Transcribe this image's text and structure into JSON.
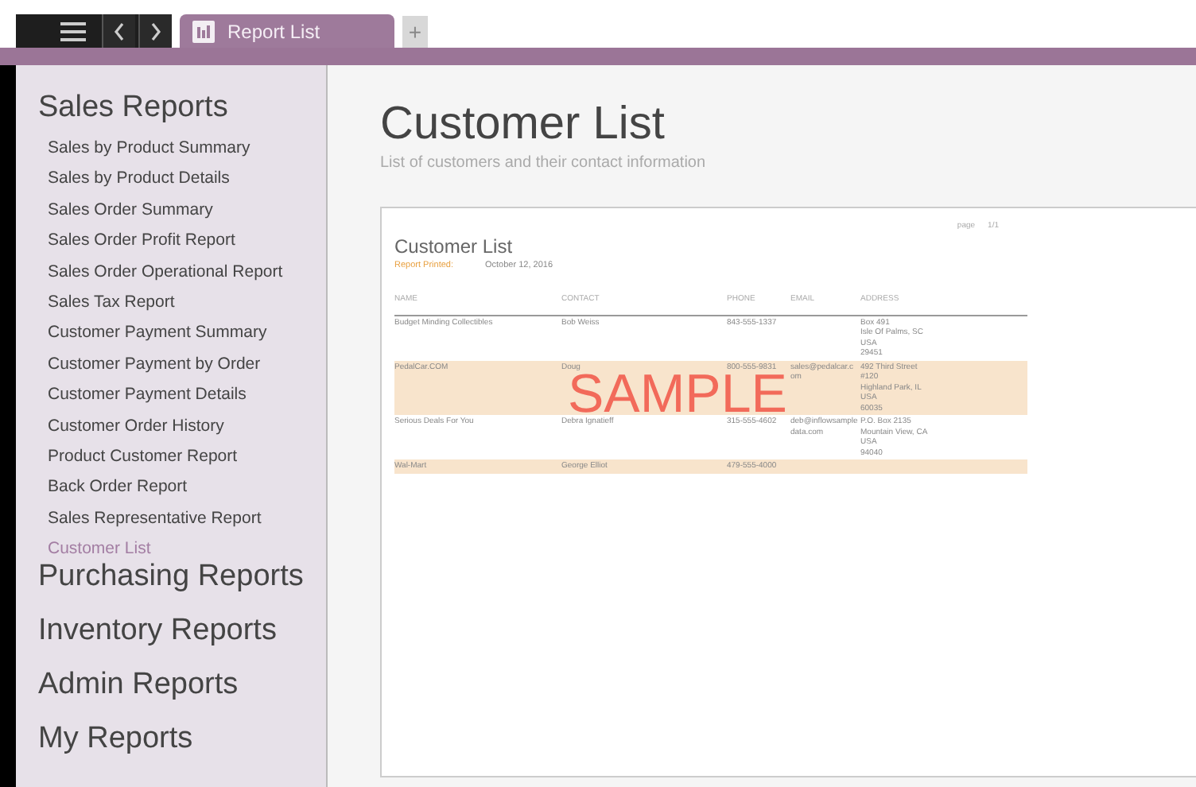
{
  "toolbar": {
    "tabs": [
      {
        "label": "Report List",
        "selected": true
      }
    ],
    "new_tab": "+"
  },
  "sidebar": {
    "groups": [
      {
        "title": "Sales Reports",
        "expanded": true,
        "items": [
          {
            "label": "Sales by Product Summary",
            "selected": false
          },
          {
            "label": "Sales by Product Details",
            "selected": false
          },
          {
            "label": "Sales Order Summary",
            "selected": false
          },
          {
            "label": "Sales Order Profit Report",
            "selected": false
          },
          {
            "label": "Sales Order Operational Report",
            "selected": false
          },
          {
            "label": "Sales Tax Report",
            "selected": false
          },
          {
            "label": "Customer Payment Summary",
            "selected": false
          },
          {
            "label": "Customer Payment by Order",
            "selected": false
          },
          {
            "label": "Customer Payment Details",
            "selected": false
          },
          {
            "label": "Customer Order History",
            "selected": false
          },
          {
            "label": "Product Customer Report",
            "selected": false
          },
          {
            "label": "Back Order Report",
            "selected": false
          },
          {
            "label": "Sales Representative Report",
            "selected": false
          },
          {
            "label": "Customer List",
            "selected": true
          }
        ]
      },
      {
        "title": "Purchasing Reports",
        "expanded": false
      },
      {
        "title": "Inventory Reports",
        "expanded": false
      },
      {
        "title": "Admin Reports",
        "expanded": false
      },
      {
        "title": "My Reports",
        "expanded": false
      }
    ]
  },
  "main": {
    "title": "Customer List",
    "subtitle": "List of customers and their contact information"
  },
  "report": {
    "title": "Customer List",
    "printed_label": "Report Printed:",
    "printed_date": "October 12, 2016",
    "page_label": "page",
    "page_number": "1/1",
    "watermark": "SAMPLE",
    "columns": [
      "NAME",
      "CONTACT",
      "PHONE",
      "EMAIL",
      "ADDRESS"
    ],
    "rows": [
      {
        "highlighted": false,
        "cells": [
          "Budget Minding Collectibles",
          "Bob Weiss",
          "843-555-1337",
          "",
          [
            "Box 491",
            "Isle Of Palms, SC",
            "USA",
            "29451"
          ]
        ]
      },
      {
        "highlighted": true,
        "cells": [
          "PedalCar.COM",
          "Doug",
          "800-555-9831",
          "sales@pedalcar.c om",
          [
            "492 Third Street",
            "#120",
            "Highland Park, IL",
            "USA",
            "60035"
          ]
        ]
      },
      {
        "highlighted": false,
        "cells": [
          "Serious Deals For You",
          "Debra Ignatieff",
          "315-555-4602",
          "deb@inflowsample data.com",
          [
            "P.O. Box 2135",
            "Mountain View, CA",
            "USA",
            "94040"
          ]
        ]
      },
      {
        "highlighted": true,
        "cells": [
          "Wal-Mart",
          "George Elliot",
          "479-555-4000",
          "",
          []
        ]
      }
    ]
  }
}
